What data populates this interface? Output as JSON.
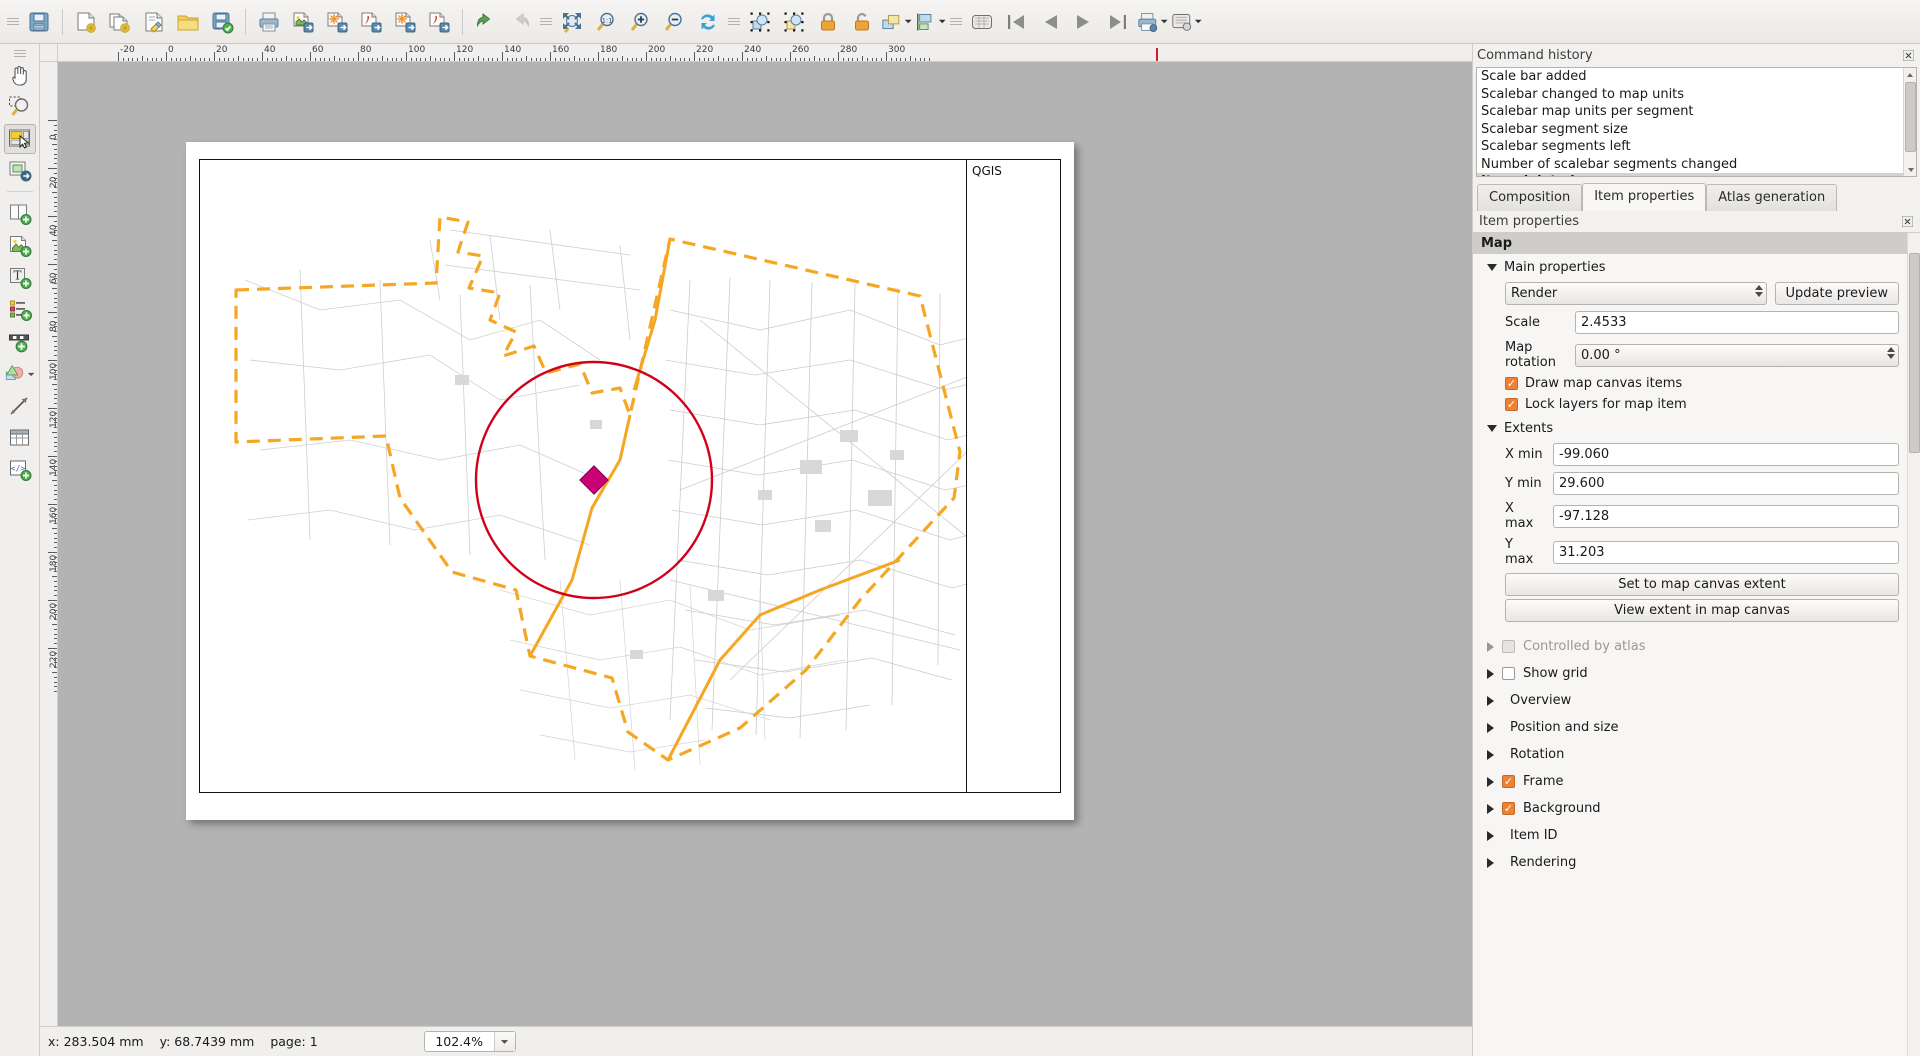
{
  "toolbar": {
    "buttons": [
      {
        "name": "save-project",
        "icon": "floppy-disk-icon",
        "disabled": false
      },
      {
        "name": "new-composer",
        "icon": "new-composer-icon",
        "disabled": false
      },
      {
        "name": "duplicate-composer",
        "icon": "duplicate-composer-icon",
        "disabled": false
      },
      {
        "name": "composer-manager",
        "icon": "composer-manager-icon",
        "disabled": false
      },
      {
        "name": "load-from-template",
        "icon": "open-folder-icon",
        "disabled": false
      },
      {
        "name": "save-as-template",
        "icon": "save-template-icon",
        "disabled": false
      },
      {
        "name": "print",
        "icon": "printer-icon",
        "disabled": false
      },
      {
        "name": "export-as-image",
        "icon": "export-image-icon",
        "disabled": false
      },
      {
        "name": "export-as-svg",
        "icon": "export-svg-icon",
        "disabled": false
      },
      {
        "name": "export-as-pdf",
        "icon": "export-pdf-icon",
        "disabled": false
      },
      {
        "name": "atlas-export-svg",
        "icon": "atlas-export-svg-icon",
        "disabled": false
      },
      {
        "name": "atlas-export-pdf",
        "icon": "atlas-export-pdf-icon",
        "disabled": false
      },
      {
        "name": "undo",
        "icon": "undo-arrow-icon",
        "disabled": false
      },
      {
        "name": "redo",
        "icon": "redo-arrow-icon",
        "disabled": true
      },
      {
        "name": "zoom-full",
        "icon": "zoom-full-icon",
        "disabled": false
      },
      {
        "name": "zoom-100",
        "icon": "zoom-one-to-one-icon",
        "disabled": false
      },
      {
        "name": "zoom-in",
        "icon": "zoom-in-icon",
        "disabled": false
      },
      {
        "name": "zoom-out",
        "icon": "zoom-out-icon",
        "disabled": false
      },
      {
        "name": "refresh-view",
        "icon": "refresh-icon",
        "disabled": false
      },
      {
        "name": "group-items",
        "icon": "group-items-icon",
        "disabled": false
      },
      {
        "name": "ungroup-items",
        "icon": "ungroup-items-icon",
        "disabled": false
      },
      {
        "name": "lock-items",
        "icon": "lock-closed-icon",
        "disabled": false
      },
      {
        "name": "unlock-all-items",
        "icon": "lock-open-icon",
        "disabled": false
      },
      {
        "name": "raise-lower-items",
        "icon": "raise-items-icon",
        "disabled": false
      },
      {
        "name": "align-items",
        "icon": "align-items-icon",
        "disabled": false
      },
      {
        "name": "atlas-preview",
        "icon": "atlas-preview-icon",
        "disabled": false
      },
      {
        "name": "atlas-first-feature",
        "icon": "skip-first-icon",
        "disabled": false
      },
      {
        "name": "atlas-prev-feature",
        "icon": "prev-arrow-icon",
        "disabled": false
      },
      {
        "name": "atlas-next-feature",
        "icon": "next-arrow-icon",
        "disabled": false
      },
      {
        "name": "atlas-last-feature",
        "icon": "skip-last-icon",
        "disabled": false
      },
      {
        "name": "print-atlas",
        "icon": "print-atlas-icon",
        "disabled": false
      },
      {
        "name": "atlas-settings",
        "icon": "atlas-settings-icon",
        "disabled": false
      }
    ]
  },
  "lefttools": {
    "buttons": [
      {
        "name": "pan-tool",
        "icon": "hand-pan-icon",
        "active": false
      },
      {
        "name": "zoom-tool",
        "icon": "zoom-magnifier-icon",
        "active": false
      },
      {
        "name": "select-move-item-tool",
        "icon": "select-item-icon",
        "active": true
      },
      {
        "name": "move-item-content-tool",
        "icon": "move-content-icon",
        "active": false
      },
      {
        "name": "add-new-map",
        "icon": "add-map-icon",
        "active": false
      },
      {
        "name": "add-image",
        "icon": "add-image-icon",
        "active": false
      },
      {
        "name": "add-label",
        "icon": "add-label-icon",
        "active": false
      },
      {
        "name": "add-legend",
        "icon": "add-legend-icon",
        "active": false
      },
      {
        "name": "add-scalebar",
        "icon": "add-scalebar-icon",
        "active": false
      },
      {
        "name": "add-shape",
        "icon": "add-shape-icon",
        "active": false
      },
      {
        "name": "add-arrow",
        "icon": "add-arrow-icon",
        "active": false
      },
      {
        "name": "add-attribute-table",
        "icon": "add-table-icon",
        "active": false
      },
      {
        "name": "add-html-frame",
        "icon": "add-html-icon",
        "active": false
      }
    ]
  },
  "rulers": {
    "horizontal_labels": [
      "-20",
      "0",
      "20",
      "40",
      "60",
      "80",
      "100",
      "120",
      "140",
      "160",
      "180",
      "200",
      "220",
      "240",
      "260",
      "280",
      "300"
    ],
    "vertical_labels": [
      "0",
      "20",
      "40",
      "60",
      "80",
      "100",
      "120",
      "140",
      "160",
      "180",
      "200",
      "220"
    ],
    "units": "mm"
  },
  "composer": {
    "legend_frame_label": "QGIS"
  },
  "command_history": {
    "title": "Command history",
    "items": [
      {
        "label": "Scale bar added",
        "selected": false
      },
      {
        "label": "Scalebar changed to map units",
        "selected": false
      },
      {
        "label": "Scalebar map units per segment",
        "selected": false
      },
      {
        "label": "Scalebar segment size",
        "selected": false
      },
      {
        "label": "Scalebar segments left",
        "selected": false
      },
      {
        "label": "Number of scalebar segments changed",
        "selected": false
      },
      {
        "label": "Item deleted",
        "selected": true
      }
    ]
  },
  "tabs": [
    {
      "label": "Composition",
      "active": false,
      "name": "tab-composition"
    },
    {
      "label": "Item properties",
      "active": true,
      "name": "tab-item-properties"
    },
    {
      "label": "Atlas generation",
      "active": false,
      "name": "tab-atlas-generation"
    }
  ],
  "item_properties": {
    "panel_title": "Item properties",
    "group_title": "Map",
    "main_properties": {
      "title": "Main properties",
      "render_mode": "Render",
      "update_preview_label": "Update preview",
      "scale_label": "Scale",
      "scale_value": "2.4533",
      "map_rotation_label": "Map rotation",
      "map_rotation_value": "0.00 °",
      "draw_map_canvas_items_label": "Draw map canvas items",
      "draw_map_canvas_items_checked": true,
      "lock_layers_label": "Lock layers for map item",
      "lock_layers_checked": true
    },
    "extents": {
      "title": "Extents",
      "x_min_label": "X min",
      "x_min_value": "-99.060",
      "y_min_label": "Y min",
      "y_min_value": "29.600",
      "x_max_label": "X max",
      "x_max_value": "-97.128",
      "y_max_label": "Y max",
      "y_max_value": "31.203",
      "set_to_canvas_extent_label": "Set to map canvas extent",
      "view_extent_label": "View extent in map canvas"
    },
    "collapsed_sections": [
      {
        "label": "Controlled by atlas",
        "has_checkbox": true,
        "checked": false,
        "disabled": true,
        "name": "section-controlled-by-atlas"
      },
      {
        "label": "Show grid",
        "has_checkbox": true,
        "checked": false,
        "disabled": false,
        "name": "section-show-grid"
      },
      {
        "label": "Overview",
        "has_checkbox": false,
        "checked": false,
        "disabled": false,
        "name": "section-overview"
      },
      {
        "label": "Position and size",
        "has_checkbox": false,
        "checked": false,
        "disabled": false,
        "name": "section-position-and-size"
      },
      {
        "label": "Rotation",
        "has_checkbox": false,
        "checked": false,
        "disabled": false,
        "name": "section-rotation"
      },
      {
        "label": "Frame",
        "has_checkbox": true,
        "checked": true,
        "disabled": false,
        "name": "section-frame"
      },
      {
        "label": "Background",
        "has_checkbox": true,
        "checked": true,
        "disabled": false,
        "name": "section-background"
      },
      {
        "label": "Item ID",
        "has_checkbox": false,
        "checked": false,
        "disabled": false,
        "name": "section-item-id"
      },
      {
        "label": "Rendering",
        "has_checkbox": false,
        "checked": false,
        "disabled": false,
        "name": "section-rendering"
      }
    ]
  },
  "statusbar": {
    "x": "x: 283.504 mm",
    "y": "y: 68.7439 mm",
    "page": "page: 1",
    "zoom": "102.4%"
  },
  "colors": {
    "accent_orange": "#ef8232",
    "map_boundary": "#f5a623",
    "map_circle": "#d0021b",
    "map_point": "#cc0077",
    "road_gray": "#c9c9c9"
  }
}
